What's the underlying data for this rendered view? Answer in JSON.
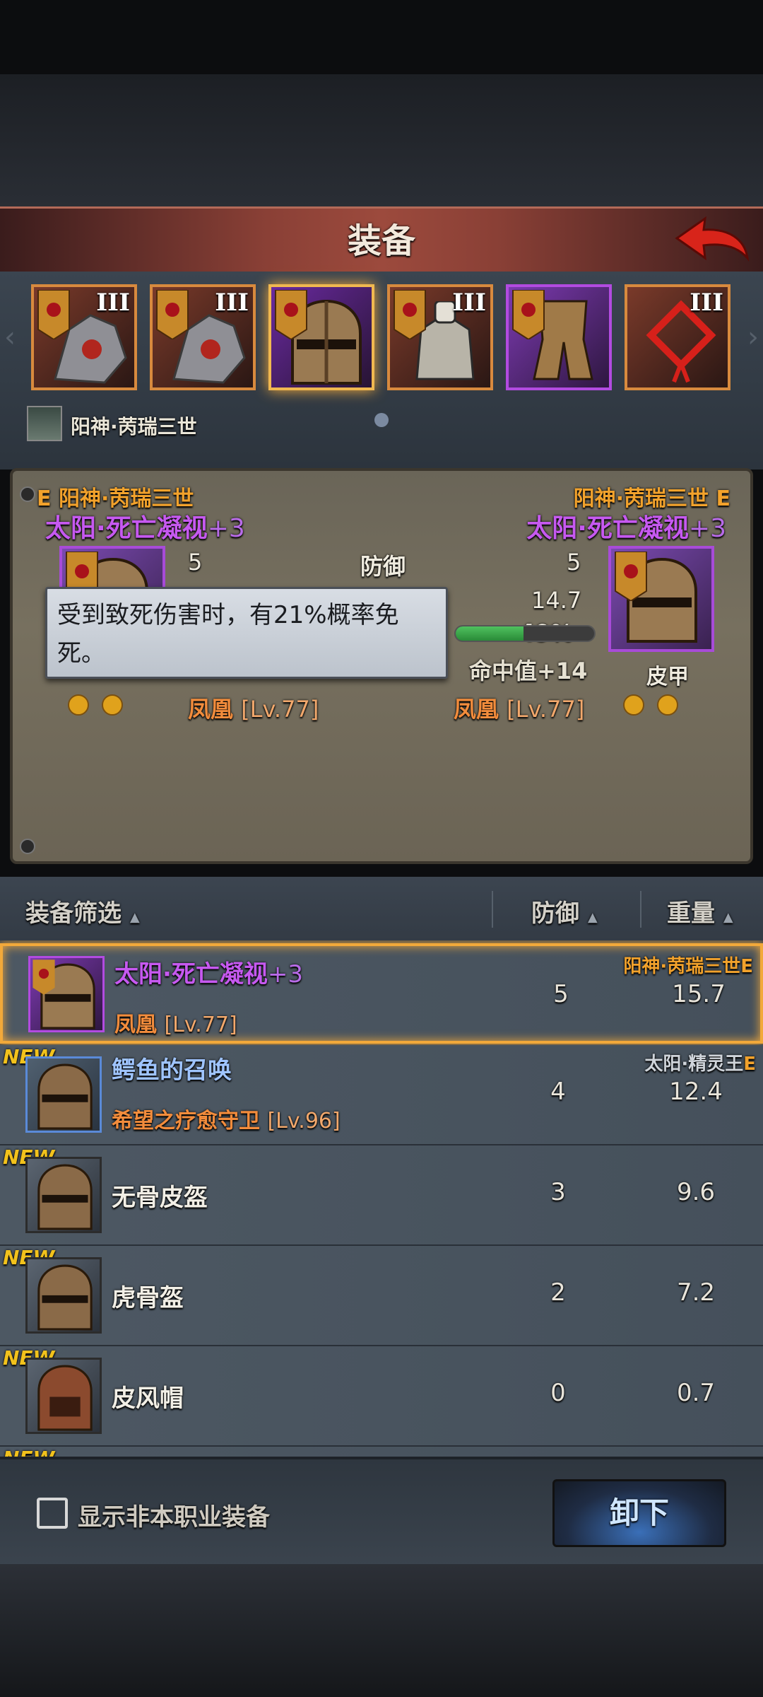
{
  "header": {
    "title": "装备"
  },
  "slots": [
    {
      "rank": "III"
    },
    {
      "rank": "III"
    },
    {
      "rank": ""
    },
    {
      "rank": "III"
    },
    {
      "rank": ""
    },
    {
      "rank": "III"
    }
  ],
  "character": {
    "name": "阳神·苪瑞三世"
  },
  "compare": {
    "left": {
      "rarity": "E",
      "owner": "阳神·苪瑞三世",
      "name": "太阳·死亡凝视",
      "plus": "+3",
      "defense": "5",
      "source_name": "凤凰",
      "source_level": "[Lv.77]"
    },
    "right": {
      "rarity": "E",
      "owner": "阳神·苪瑞三世",
      "name": "太阳·死亡凝视",
      "plus": "+3",
      "defense": "5",
      "weight": "14.7",
      "percent_label": "49%",
      "percent_value": 0.49,
      "bonus": "命中值+14",
      "type": "皮甲",
      "source_name": "凤凰",
      "source_level": "[Lv.77]"
    },
    "stat_label": "防御",
    "tooltip": "受到致死伤害时，有21%概率免死。"
  },
  "list": {
    "headers": {
      "filter": "装备筛选",
      "defense": "防御",
      "weight": "重量"
    },
    "items": [
      {
        "name": "太阳·死亡凝视",
        "plus": "+3",
        "source_name": "凤凰",
        "source_level": "[Lv.77]",
        "owner": "阳神·苪瑞三世",
        "owner_rarity": "E",
        "defense": "5",
        "weight": "15.7",
        "new": "",
        "selected": true
      },
      {
        "name": "鳄鱼的召唤",
        "source_name": "希望之疗愈守卫",
        "source_level": "[Lv.96]",
        "owner": "太阳·精灵王",
        "owner_rarity": "E",
        "defense": "4",
        "weight": "12.4",
        "new": "NEW"
      },
      {
        "name": "无骨皮盔",
        "defense": "3",
        "weight": "9.6",
        "new": "NEW"
      },
      {
        "name": "虎骨盔",
        "defense": "2",
        "weight": "7.2",
        "new": "NEW"
      },
      {
        "name": "皮风帽",
        "defense": "0",
        "weight": "0.7",
        "new": "NEW"
      },
      {
        "new": "NEW"
      }
    ]
  },
  "footer": {
    "checkbox_label": "显示非本职业装备",
    "unequip_label": "卸下"
  },
  "colors": {
    "accent_orange": "#f2a93a",
    "epic_purple": "#c659f0",
    "source_orange": "#f28c3c"
  }
}
